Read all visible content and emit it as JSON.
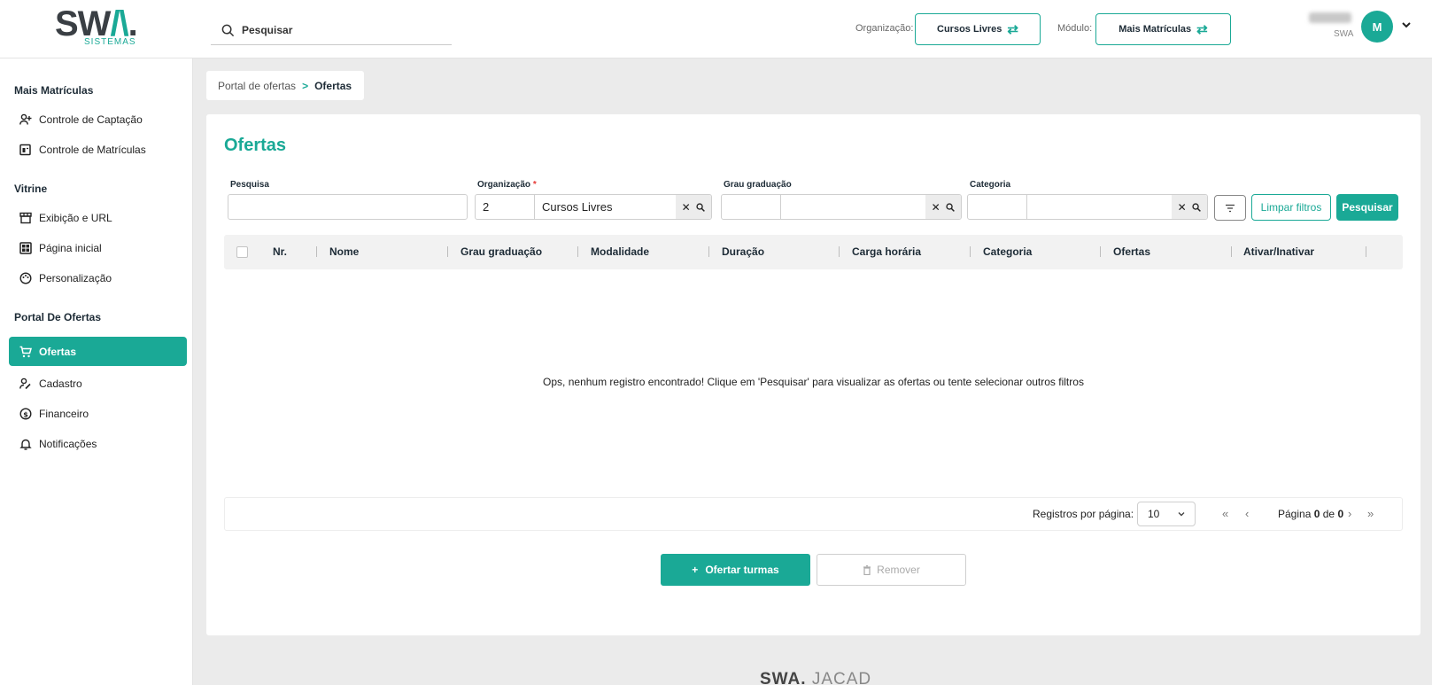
{
  "header": {
    "logo_text": "SWA.",
    "logo_sub": "SISTEMAS",
    "search_placeholder": "Pesquisar",
    "organization_label": "Organização:",
    "organization_value": "Cursos Livres",
    "module_label": "Módulo:",
    "module_value": "Mais Matrículas",
    "user_org": "SWA",
    "avatar_initial": "M",
    "accent_color": "#1aa996"
  },
  "sidebar": {
    "sections": [
      {
        "title": "Mais Matrículas"
      },
      {
        "title": "Vitrine"
      },
      {
        "title": "Portal De Ofertas"
      }
    ],
    "items": [
      {
        "label": "Controle de Captação",
        "icon": "user-plus-icon"
      },
      {
        "label": "Controle de Matrículas",
        "icon": "document-edit-icon"
      },
      {
        "label": "Exibição e URL",
        "icon": "storefront-icon"
      },
      {
        "label": "Página inicial",
        "icon": "grid-icon"
      },
      {
        "label": "Personalização",
        "icon": "palette-icon"
      },
      {
        "label": "Ofertas",
        "icon": "cart-icon",
        "active": true
      },
      {
        "label": "Cadastro",
        "icon": "user-edit-icon"
      },
      {
        "label": "Financeiro",
        "icon": "dollar-circle-icon"
      },
      {
        "label": "Notificações",
        "icon": "bell-icon"
      }
    ]
  },
  "breadcrumb": {
    "parent": "Portal de ofertas",
    "current": "Ofertas"
  },
  "main": {
    "title": "Ofertas",
    "filters": {
      "search_label": "Pesquisa",
      "search_value": "",
      "org_label": "Organização",
      "org_required_mark": "*",
      "org_code": "2",
      "org_name": "Cursos Livres",
      "grau_label": "Grau graduação",
      "grau_code": "",
      "grau_name": "",
      "categoria_label": "Categoria",
      "categoria_code": "",
      "categoria_name": "",
      "clear_label": "Limpar filtros",
      "search_button": "Pesquisar"
    },
    "table": {
      "columns": [
        "Nr.",
        "Nome",
        "Grau graduação",
        "Modalidade",
        "Duração",
        "Carga horária",
        "Categoria",
        "Ofertas",
        "Ativar/Inativar"
      ],
      "rows": [],
      "empty_message": "Ops, nenhum registro encontrado! Clique em 'Pesquisar' para visualizar as ofertas ou tente selecionar outros filtros"
    },
    "pagination": {
      "per_page_label": "Registros por página:",
      "per_page_value": "10",
      "page_prefix": "Página",
      "current_page": "0",
      "of_label": "de",
      "total_pages": "0"
    },
    "actions": {
      "offer_label": "Ofertar turmas",
      "remove_label": "Remover"
    }
  },
  "footer": {
    "brand_bold": "SWA.",
    "brand_light": "JACAD"
  }
}
